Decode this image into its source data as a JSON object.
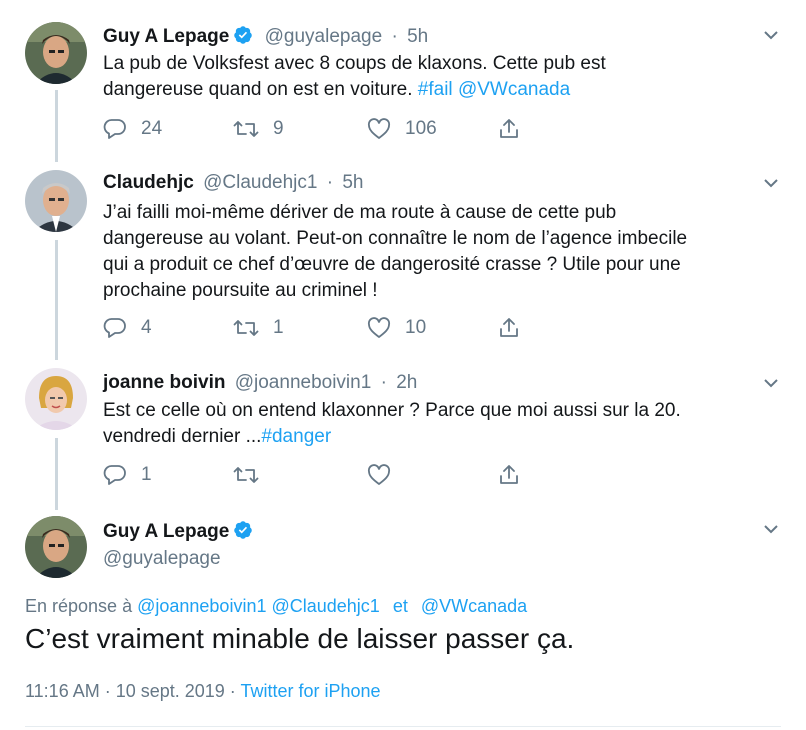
{
  "colors": {
    "accent": "#1da1f2",
    "secondary_text": "#657786",
    "verified": "#1da1f2",
    "thread_line": "#ccd6dd"
  },
  "tweets": [
    {
      "name": "Guy A Lepage",
      "handle": "@guyalepage",
      "separator": "·",
      "time": "5h",
      "verified": true,
      "text_plain": "La pub de Volksfest avec 8 coups de klaxons. Cette pub est\ndangereuse quand on est en voiture. ",
      "hashtag": "#fail",
      "mention": "@VWcanada",
      "replies": "24",
      "retweets": "9",
      "likes": "106"
    },
    {
      "name": "Claudehjc",
      "handle": "@Claudehjc1",
      "separator": "·",
      "time": "5h",
      "text": "J’ai failli moi-même dériver de ma route à cause de cette pub\ndangereuse au volant. Peut-on connaître le nom de l’agence imbecile\nqui a produit ce chef d’œuvre de dangerosité crasse ?  Utile pour une\nprochaine poursuite au criminel !",
      "replies": "4",
      "retweets": "1",
      "likes": "10"
    },
    {
      "name": "joanne boivin",
      "handle": "@joanneboivin1",
      "separator": "·",
      "time": "2h",
      "text_plain": "Est ce celle où on entend klaxonner ? Parce que moi aussi sur la 20.\nvendredi dernier ...",
      "hashtag": "#danger",
      "replies": "1",
      "retweets": "",
      "likes": ""
    }
  ],
  "main_tweet": {
    "name": "Guy A Lepage",
    "handle": "@guyalepage",
    "verified": true,
    "reply_prefix": "En réponse à",
    "reply_mention_1": "@joanneboivin1",
    "reply_mention_2": "@Claudehjc1",
    "reply_and": "et",
    "reply_mention_3": "@VWcanada",
    "text": "C’est vraiment minable de laisser passer ça.",
    "timestamp": "11:16 AM · 10 sept. 2019 ·",
    "source": "Twitter for iPhone"
  },
  "icons": [
    "reply-icon",
    "retweet-icon",
    "like-icon",
    "share-icon",
    "verified-badge-icon",
    "chevron-down-icon"
  ]
}
